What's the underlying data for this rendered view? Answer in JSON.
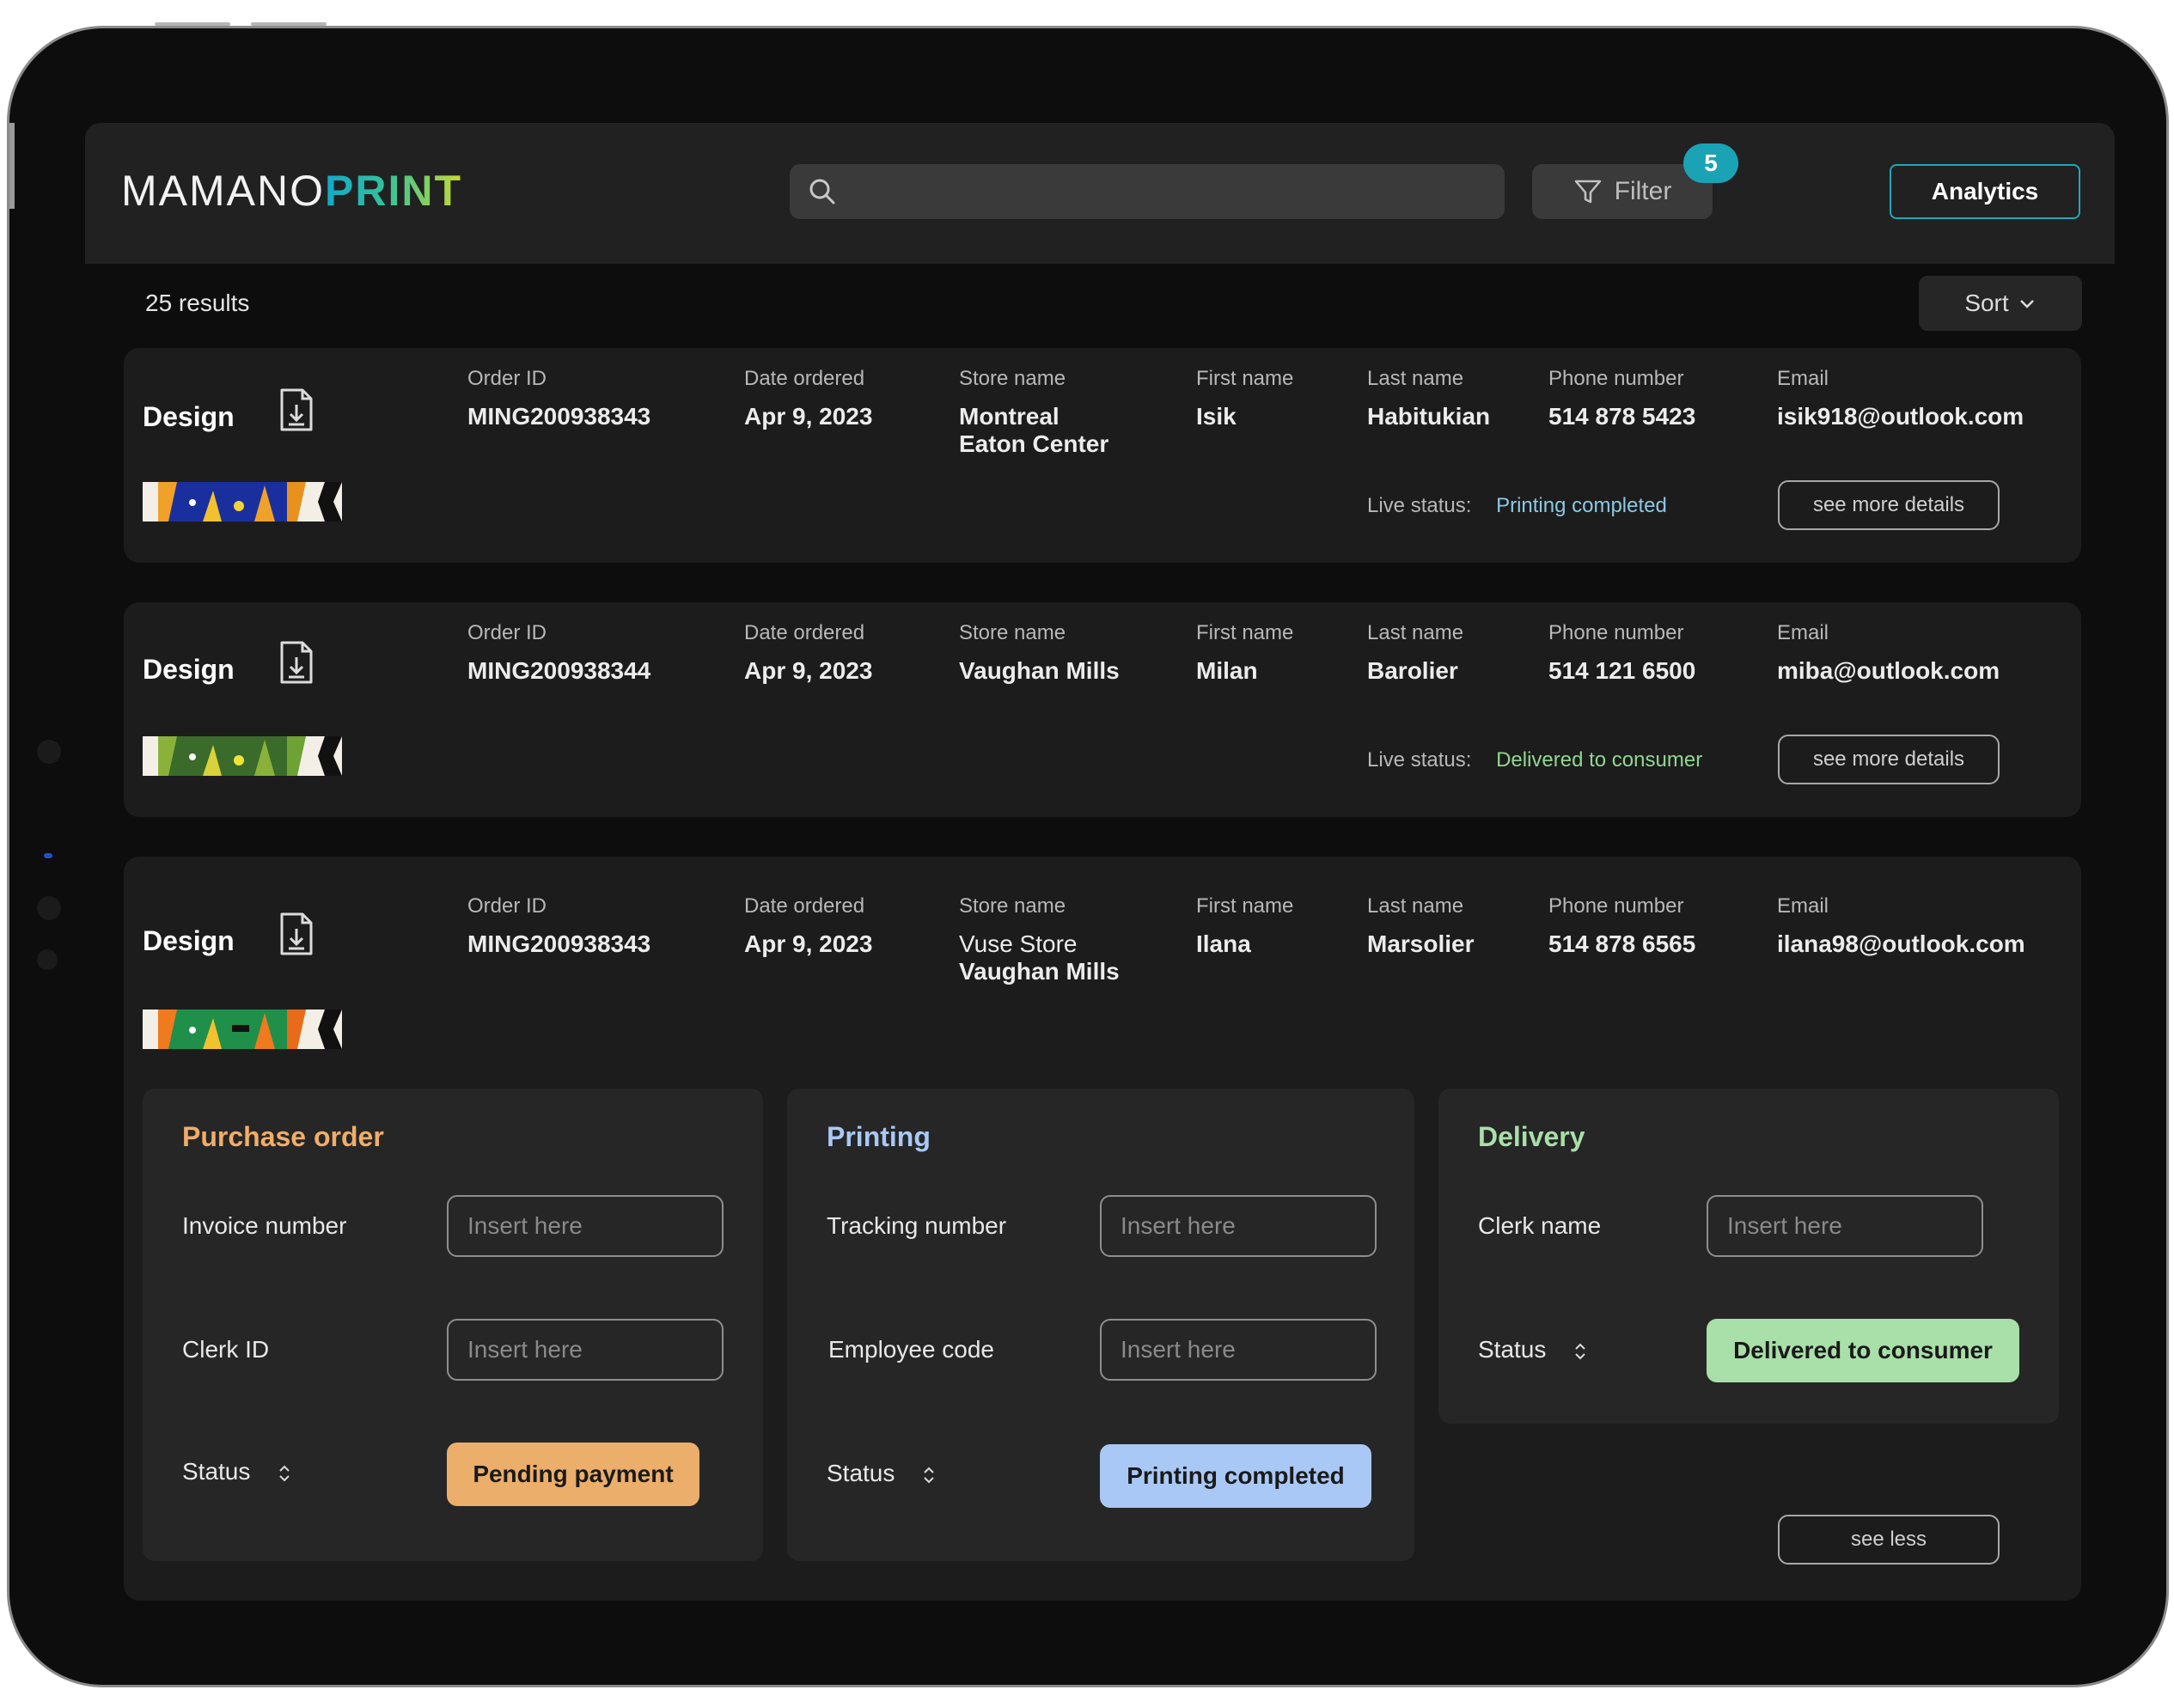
{
  "brand": {
    "part1": "MAMANO",
    "part2": "PRINT"
  },
  "search": {
    "placeholder": ""
  },
  "filter": {
    "label": "Filter",
    "count": "5"
  },
  "analytics_label": "Analytics",
  "results_label": "25 results",
  "sort_label": "Sort",
  "design_label": "Design",
  "columns": {
    "order_id": "Order ID",
    "date": "Date ordered",
    "store": "Store name",
    "first": "First name",
    "last": "Last name",
    "phone": "Phone number",
    "email": "Email"
  },
  "live_status_label": "Live status:",
  "see_more_label": "see more details",
  "see_less_label": "see less",
  "colors": {
    "accent_teal": "#1fa8b8",
    "status_blue": "#9ed3ea",
    "status_green": "#9fdca0",
    "pending": "#ebae6b",
    "printing": "#a9c8f5",
    "delivered": "#a9dfa9"
  },
  "orders": [
    {
      "order_id": "MING200938343",
      "date": "Apr 9, 2023",
      "store_line1": "Montreal",
      "store_line2": "Eaton Center",
      "first": "Isik",
      "last": "Habitukian",
      "phone": "514 878 5423",
      "email": "isik918@outlook.com",
      "status": "Printing completed"
    },
    {
      "order_id": "MING200938344",
      "date": "Apr 9, 2023",
      "store_line1": "Vaughan Mills",
      "store_line2": "",
      "first": "Milan",
      "last": "Barolier",
      "phone": "514 121 6500",
      "email": "miba@outlook.com",
      "status": "Delivered to consumer"
    },
    {
      "order_id": "MING200938343",
      "date": "Apr 9, 2023",
      "store_line1": "Vuse Store",
      "store_line2": "Vaughan Mills",
      "first": "Ilana",
      "last": "Marsolier",
      "phone": "514 878 6565",
      "email": "ilana98@outlook.com"
    }
  ],
  "panels": {
    "purchase": {
      "title": "Purchase order",
      "field1_label": "Invoice number",
      "field2_label": "Clerk ID",
      "status_label": "Status",
      "status_value": "Pending payment",
      "placeholder": "Insert here"
    },
    "printing": {
      "title": "Printing",
      "field1_label": "Tracking number",
      "field2_label": "Employee code",
      "status_label": "Status",
      "status_value": "Printing completed",
      "placeholder": "Insert here"
    },
    "delivery": {
      "title": "Delivery",
      "field1_label": "Clerk name",
      "status_label": "Status",
      "status_value": "Delivered to consumer",
      "placeholder": "Insert here"
    }
  }
}
